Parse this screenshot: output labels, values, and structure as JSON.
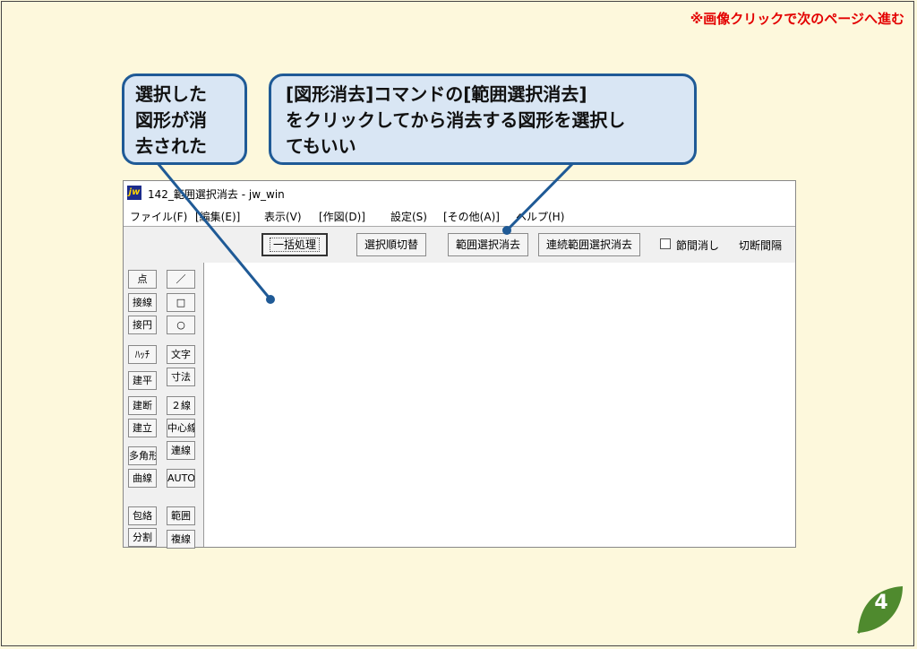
{
  "top_note": "※画像クリックで次のページへ進む",
  "callout_left": {
    "lines": [
      "選択した",
      "図形が消",
      "去された"
    ]
  },
  "callout_right": {
    "lines": [
      "[図形消去]コマンドの[範囲選択消去]",
      "をクリックしてから消去する図形を選択し",
      "てもいい"
    ]
  },
  "window": {
    "icon_text": "jw",
    "title": "142_範囲選択消去 - jw_win",
    "menu": [
      "ファイル(F)",
      "[編集(E)]",
      "表示(V)",
      "[作図(D)]",
      "設定(S)",
      "[その他(A)]",
      "ヘルプ(H)"
    ],
    "toolbar": {
      "buttons": [
        "一括処理",
        "選択順切替",
        "範囲選択消去",
        "連続範囲選択消去"
      ],
      "checkbox_label": "節間消し",
      "extra_label": "切断間隔"
    },
    "side_left": [
      "点",
      "接線",
      "接円",
      "ﾊｯﾁ",
      "建平",
      "建断",
      "建立",
      "多角形",
      "曲線",
      "包絡",
      "分割"
    ],
    "side_right": [
      "／",
      "□",
      "○",
      "文字",
      "寸法",
      "２線",
      "中心線",
      "連線",
      "AUTO",
      "範囲",
      "複線"
    ]
  },
  "page_number": "4",
  "colors": {
    "accent_red": "#e30000",
    "callout_border": "#1f5a96",
    "callout_fill": "#d9e6f4",
    "leaf_green": "#4f8a2e"
  }
}
